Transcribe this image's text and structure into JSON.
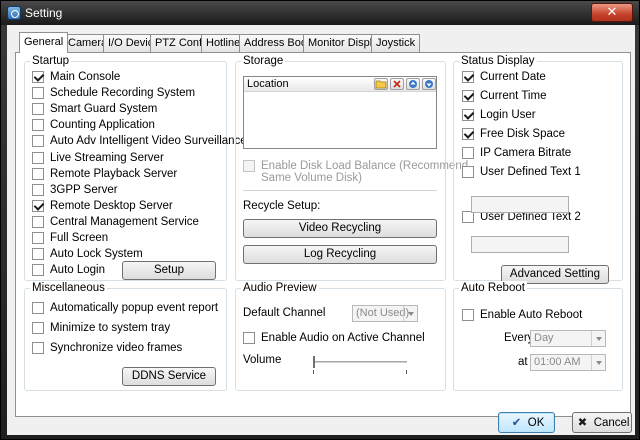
{
  "window": {
    "title": "Setting",
    "close_glyph": "✕"
  },
  "tabs": [
    {
      "label": "General",
      "active": true
    },
    {
      "label": "Camera"
    },
    {
      "label": "I/O Device"
    },
    {
      "label": "PTZ Config"
    },
    {
      "label": "Hotline"
    },
    {
      "label": "Address Book"
    },
    {
      "label": "Monitor Display"
    },
    {
      "label": "Joystick"
    }
  ],
  "startup": {
    "title": "Startup",
    "items": [
      {
        "label": "Main Console",
        "checked": true
      },
      {
        "label": "Schedule Recording System",
        "checked": false
      },
      {
        "label": "Smart Guard System",
        "checked": false
      },
      {
        "label": "Counting Application",
        "checked": false
      },
      {
        "label": "Auto Adv Intelligent Video Surveillance",
        "checked": false
      },
      {
        "label": "Live Streaming Server",
        "checked": false
      },
      {
        "label": "Remote Playback Server",
        "checked": false
      },
      {
        "label": "3GPP Server",
        "checked": false
      },
      {
        "label": "Remote Desktop Server",
        "checked": true
      },
      {
        "label": "Central Management Service",
        "checked": false
      },
      {
        "label": "Full Screen",
        "checked": false
      },
      {
        "label": "Auto Lock System",
        "checked": false
      },
      {
        "label": "Auto Login",
        "checked": false
      }
    ],
    "setup_button": "Setup"
  },
  "storage": {
    "title": "Storage",
    "list_header": "Location",
    "disk_balance_line1": "Enable Disk Load Balance (Recommend",
    "disk_balance_line2": "Same Volume Disk)",
    "recycle_label": "Recycle Setup:",
    "video_recycling": "Video Recycling",
    "log_recycling": "Log Recycling"
  },
  "status_display": {
    "title": "Status Display",
    "items": [
      {
        "label": "Current Date",
        "checked": true
      },
      {
        "label": "Current Time",
        "checked": true
      },
      {
        "label": "Login User",
        "checked": true
      },
      {
        "label": "Free Disk Space",
        "checked": true
      },
      {
        "label": "IP Camera Bitrate",
        "checked": false
      },
      {
        "label": "User Defined Text 1",
        "checked": false
      },
      {
        "label": "User Defined Text 2",
        "checked": false
      }
    ],
    "advanced_button": "Advanced Setting"
  },
  "miscellaneous": {
    "title": "Miscellaneous",
    "items": [
      {
        "label": "Automatically popup event report",
        "checked": false
      },
      {
        "label": "Minimize to system tray",
        "checked": false
      },
      {
        "label": "Synchronize video frames",
        "checked": false
      }
    ],
    "ddns_button": "DDNS Service"
  },
  "audio_preview": {
    "title": "Audio Preview",
    "default_channel_label": "Default Channel",
    "default_channel_value": "(Not Used)",
    "enable_audio_label": "Enable Audio on Active Channel",
    "volume_label": "Volume",
    "volume_level": 0
  },
  "auto_reboot": {
    "title": "Auto Reboot",
    "enable_label": "Enable Auto Reboot",
    "every_label": "Every",
    "every_value": "Day",
    "at_label": "at",
    "at_value": "01:00 AM"
  },
  "footer": {
    "ok_label": "OK",
    "ok_icon": "✔",
    "cancel_label": "Cancel",
    "cancel_icon": "✖"
  },
  "colors": {
    "ok_icon": "#1f4f93",
    "cancel_icon": "#1a1a1a"
  }
}
